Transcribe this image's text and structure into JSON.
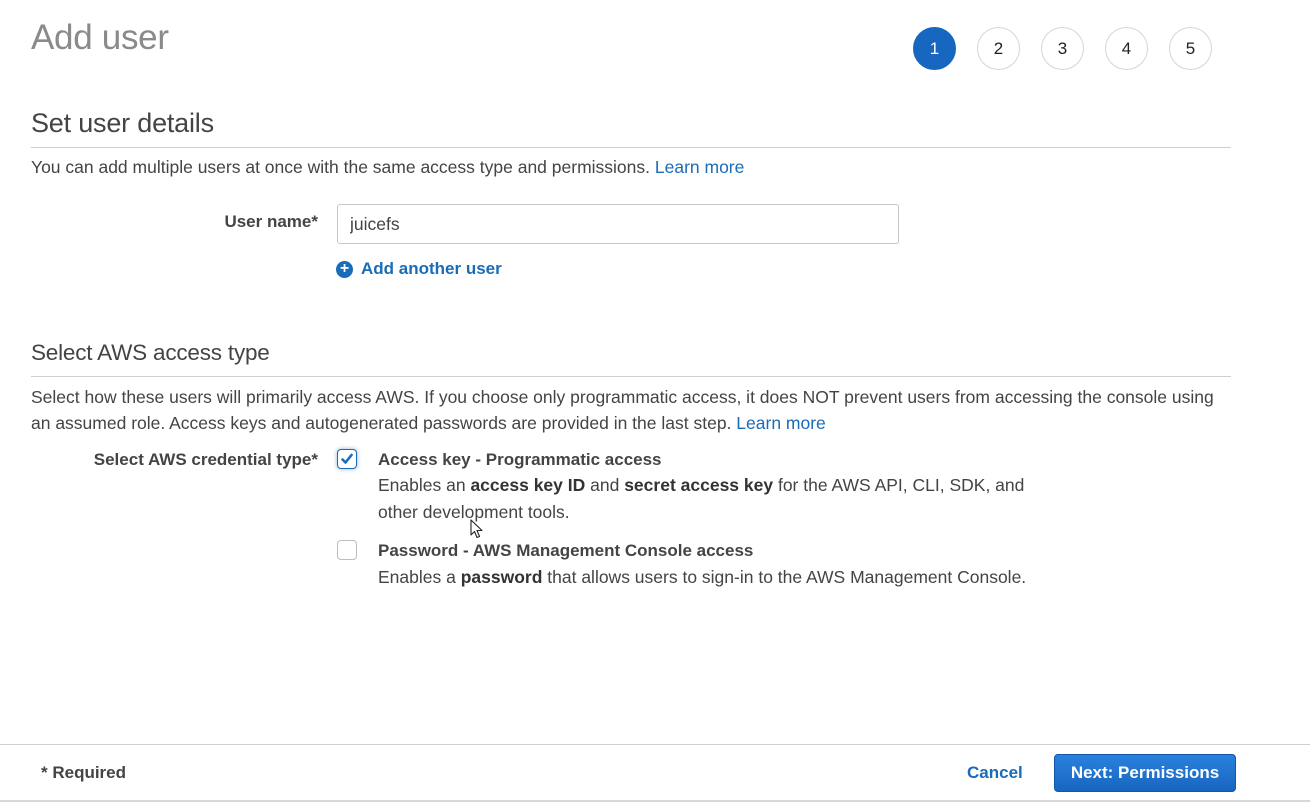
{
  "page": {
    "title": "Add user"
  },
  "stepper": {
    "current_step": 1,
    "steps": [
      "1",
      "2",
      "3",
      "4",
      "5"
    ]
  },
  "user_details": {
    "title": "Set user details",
    "description": "You can add multiple users at once with the same access type and permissions.",
    "learn_more": "Learn more",
    "user_name_label": "User name*",
    "user_name_value": "juicefs",
    "add_another_user": "Add another user"
  },
  "access_type": {
    "title": "Select AWS access type",
    "description": "Select how these users will primarily access AWS. If you choose only programmatic access, it does NOT prevent users from accessing the console using an assumed role. Access keys and autogenerated passwords are provided in the last step.",
    "learn_more": "Learn more",
    "credential_label": "Select AWS credential type*",
    "options": [
      {
        "title": "Access key - Programmatic access",
        "checked": true,
        "desc_parts": [
          "Enables an ",
          "access key ID",
          " and ",
          "secret access key",
          " for the AWS API, CLI, SDK, and other development tools."
        ]
      },
      {
        "title": "Password - AWS Management Console access",
        "checked": false,
        "desc_parts": [
          "Enables a ",
          "password",
          " that allows users to sign-in to the AWS Management Console."
        ]
      }
    ]
  },
  "footer": {
    "required_note": "* Required",
    "cancel_label": "Cancel",
    "next_label": "Next: Permissions"
  },
  "colors": {
    "accent": "#1766c0",
    "link": "#1a6bb8"
  }
}
